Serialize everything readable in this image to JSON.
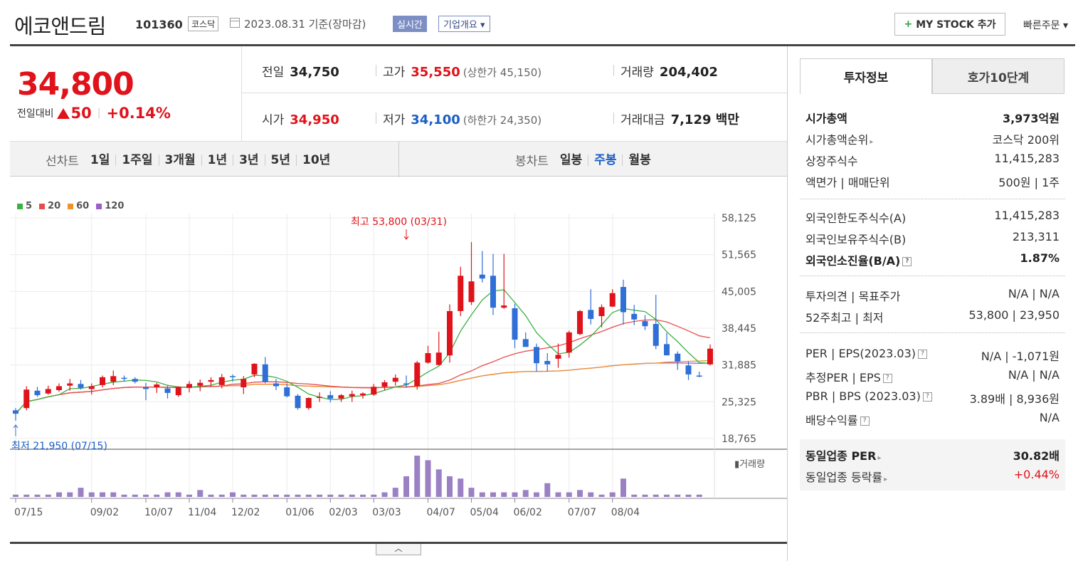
{
  "header": {
    "name": "에코앤드림",
    "code": "101360",
    "market": "코스닥",
    "date_text": "2023.08.31  기준(장마감)",
    "realtime_label": "실시간",
    "overview_label": "기업개요 ▾",
    "mystock_plus": "+",
    "mystock_label": "MY STOCK 추가",
    "quick_order": "빠른주문 ▾"
  },
  "price": {
    "current": "34,800",
    "compare_label": "전일대비",
    "change": "50",
    "change_pct": "+0.14%"
  },
  "stats": {
    "prev_label": "전일",
    "prev": "34,750",
    "high_label": "고가",
    "high": "35,550",
    "upper_limit": "(상한가 45,150)",
    "volume_label": "거래량",
    "volume": "204,402",
    "open_label": "시가",
    "open": "34,950",
    "low_label": "저가",
    "low": "34,100",
    "lower_limit": "(하한가 24,350)",
    "amount_label": "거래대금",
    "amount": "7,129 백만"
  },
  "period": {
    "label": "선차트",
    "items": [
      "1일",
      "1주일",
      "3개월",
      "1년",
      "3년",
      "5년",
      "10년"
    ],
    "candle_label": "봉차트",
    "candle_items": [
      "일봉",
      "주봉",
      "월봉"
    ],
    "active_candle": "주봉"
  },
  "legend": [
    {
      "label": "5",
      "color": "#3cb043"
    },
    {
      "label": "20",
      "color": "#e84c4c"
    },
    {
      "label": "60",
      "color": "#f0922b"
    },
    {
      "label": "120",
      "color": "#9b5fc8"
    }
  ],
  "chart_data": {
    "type": "candlestick",
    "y_ticks": [
      "58,125",
      "51,565",
      "45,005",
      "38,445",
      "31,885",
      "25,325",
      "18,765"
    ],
    "y_tick_values": [
      58125,
      51565,
      45005,
      38445,
      31885,
      25325,
      18765
    ],
    "x_ticks": [
      "07/15",
      "09/02",
      "10/07",
      "11/04",
      "12/02",
      "01/06",
      "02/03",
      "03/03",
      "04/07",
      "05/04",
      "06/02",
      "07/07",
      "08/04"
    ],
    "x_tick_index": [
      0,
      7,
      12,
      16,
      20,
      25,
      29,
      33,
      38,
      42,
      46,
      51,
      55
    ],
    "high_annotation": "최고 53,800 (03/31)",
    "high_index": 36,
    "high_value": 53800,
    "low_annotation": "최저 21,950 (07/15)",
    "low_index": 0,
    "low_value": 21950,
    "volume_label": "▮거래량",
    "candles": [
      [
        23800,
        24200,
        21950,
        23200
      ],
      [
        24200,
        28100,
        23800,
        27500
      ],
      [
        27300,
        28000,
        26200,
        26500
      ],
      [
        26800,
        28200,
        26600,
        27600
      ],
      [
        27400,
        28600,
        27100,
        28100
      ],
      [
        28200,
        29400,
        27300,
        28600
      ],
      [
        28500,
        29200,
        27500,
        27800
      ],
      [
        27600,
        28600,
        26600,
        28100
      ],
      [
        28300,
        30000,
        27900,
        29700
      ],
      [
        28900,
        30900,
        28300,
        29900
      ],
      [
        29600,
        30000,
        28900,
        29500
      ],
      [
        29400,
        29700,
        28600,
        28900
      ],
      [
        27900,
        28700,
        25600,
        27600
      ],
      [
        27900,
        28700,
        26900,
        28400
      ],
      [
        27700,
        28200,
        25900,
        26900
      ],
      [
        26500,
        28100,
        26200,
        28000
      ],
      [
        27800,
        29000,
        27000,
        28500
      ],
      [
        28200,
        29300,
        27200,
        28700
      ],
      [
        28900,
        29700,
        28100,
        29200
      ],
      [
        28300,
        30300,
        27700,
        29700
      ],
      [
        29900,
        30200,
        28900,
        29800
      ],
      [
        27900,
        29900,
        26700,
        29400
      ],
      [
        30200,
        32200,
        29700,
        32100
      ],
      [
        32000,
        33300,
        28600,
        28900
      ],
      [
        28600,
        29400,
        27400,
        28100
      ],
      [
        27900,
        28600,
        26100,
        26300
      ],
      [
        26400,
        26700,
        23900,
        24200
      ],
      [
        24200,
        26100,
        23900,
        26000
      ],
      [
        26000,
        27000,
        25300,
        26200
      ],
      [
        26500,
        27200,
        25200,
        25900
      ],
      [
        25900,
        26700,
        25300,
        26500
      ],
      [
        26300,
        27300,
        25300,
        26700
      ],
      [
        26500,
        27000,
        25900,
        26800
      ],
      [
        26600,
        28500,
        26400,
        28000
      ],
      [
        28000,
        29200,
        27400,
        28800
      ],
      [
        28900,
        30200,
        28200,
        29600
      ],
      [
        28600,
        30000,
        27800,
        28400
      ],
      [
        28100,
        32600,
        27500,
        32300
      ],
      [
        32300,
        35300,
        32100,
        34000
      ],
      [
        31900,
        37800,
        31800,
        34100
      ],
      [
        33600,
        42700,
        32300,
        41500
      ],
      [
        41500,
        49400,
        40600,
        47800
      ],
      [
        43100,
        53800,
        42600,
        46800
      ],
      [
        48000,
        52200,
        46600,
        47300
      ],
      [
        47800,
        51700,
        40800,
        42100
      ],
      [
        42100,
        51700,
        41900,
        42500
      ],
      [
        42000,
        42800,
        34900,
        36400
      ],
      [
        36500,
        37700,
        35200,
        35100
      ],
      [
        35100,
        35700,
        30700,
        32200
      ],
      [
        32600,
        34000,
        30700,
        32000
      ],
      [
        33000,
        35700,
        31400,
        33700
      ],
      [
        34100,
        38000,
        33200,
        37700
      ],
      [
        37400,
        41700,
        37200,
        41500
      ],
      [
        41700,
        45400,
        39100,
        40100
      ],
      [
        40600,
        42700,
        38600,
        42200
      ],
      [
        42300,
        45400,
        42200,
        44700
      ],
      [
        45800,
        47100,
        39100,
        41300
      ],
      [
        41000,
        42600,
        39000,
        40000
      ],
      [
        39700,
        40800,
        38100,
        38800
      ],
      [
        39200,
        44400,
        34700,
        35300
      ],
      [
        35600,
        37600,
        33600,
        33600
      ],
      [
        33900,
        34300,
        31000,
        32500
      ],
      [
        31800,
        32500,
        29200,
        30200
      ],
      [
        30000,
        30700,
        29700,
        29900
      ],
      [
        32000,
        35550,
        31800,
        34800
      ]
    ],
    "volume": [
      1,
      1,
      1,
      1,
      2,
      2,
      4,
      2,
      2,
      2,
      1,
      1,
      1,
      1,
      2,
      2,
      1,
      3,
      1,
      1,
      2,
      1,
      1,
      1,
      1,
      1,
      1,
      1,
      1,
      1,
      1,
      1,
      1,
      1,
      2,
      4,
      9,
      18,
      16,
      12,
      9,
      8,
      4,
      2,
      2,
      2,
      2,
      3,
      2,
      6,
      2,
      2,
      3,
      2,
      1,
      2,
      8,
      1,
      1,
      1,
      1,
      1,
      1,
      1
    ]
  },
  "side": {
    "tab_invest": "투자정보",
    "tab_orderbook": "호가10단계",
    "g1": [
      {
        "k": "시가총액",
        "v": "3,973억원",
        "bold": true
      },
      {
        "k": "시가총액순위",
        "v": "코스닥 200위",
        "arrow": "▸"
      },
      {
        "k": "상장주식수",
        "v": "11,415,283"
      },
      {
        "k": "액면가 | 매매단위",
        "v": "500원 | 1주"
      }
    ],
    "g2": [
      {
        "k": "외국인한도주식수(A)",
        "v": "11,415,283"
      },
      {
        "k": "외국인보유주식수(B)",
        "v": "213,311"
      },
      {
        "k": "외국인소진율(B/A)",
        "v": "1.87%",
        "bold": true,
        "q": "?"
      }
    ],
    "g3": [
      {
        "k": "투자의견 | 목표주가",
        "v": "N/A | N/A"
      },
      {
        "k": "52주최고 | 최저",
        "v": "53,800 | 23,950"
      }
    ],
    "g4": [
      {
        "k": "PER | EPS(2023.03)",
        "v": "N/A | -1,071원",
        "q": "?"
      },
      {
        "k": "추정PER | EPS",
        "v": "N/A | N/A",
        "q": "?"
      },
      {
        "k": "PBR | BPS (2023.03)",
        "v": "3.89배 | 8,936원",
        "q": "?"
      },
      {
        "k": "배당수익률",
        "v": "N/A",
        "q": "?"
      }
    ],
    "g5": [
      {
        "k": "동일업종 PER",
        "v": "30.82배",
        "bold": true,
        "arrow": "▸"
      },
      {
        "k": "동일업종 등락률",
        "v": "+0.44%",
        "arrow": "▸",
        "red": true
      }
    ],
    "collapse": "︿"
  }
}
